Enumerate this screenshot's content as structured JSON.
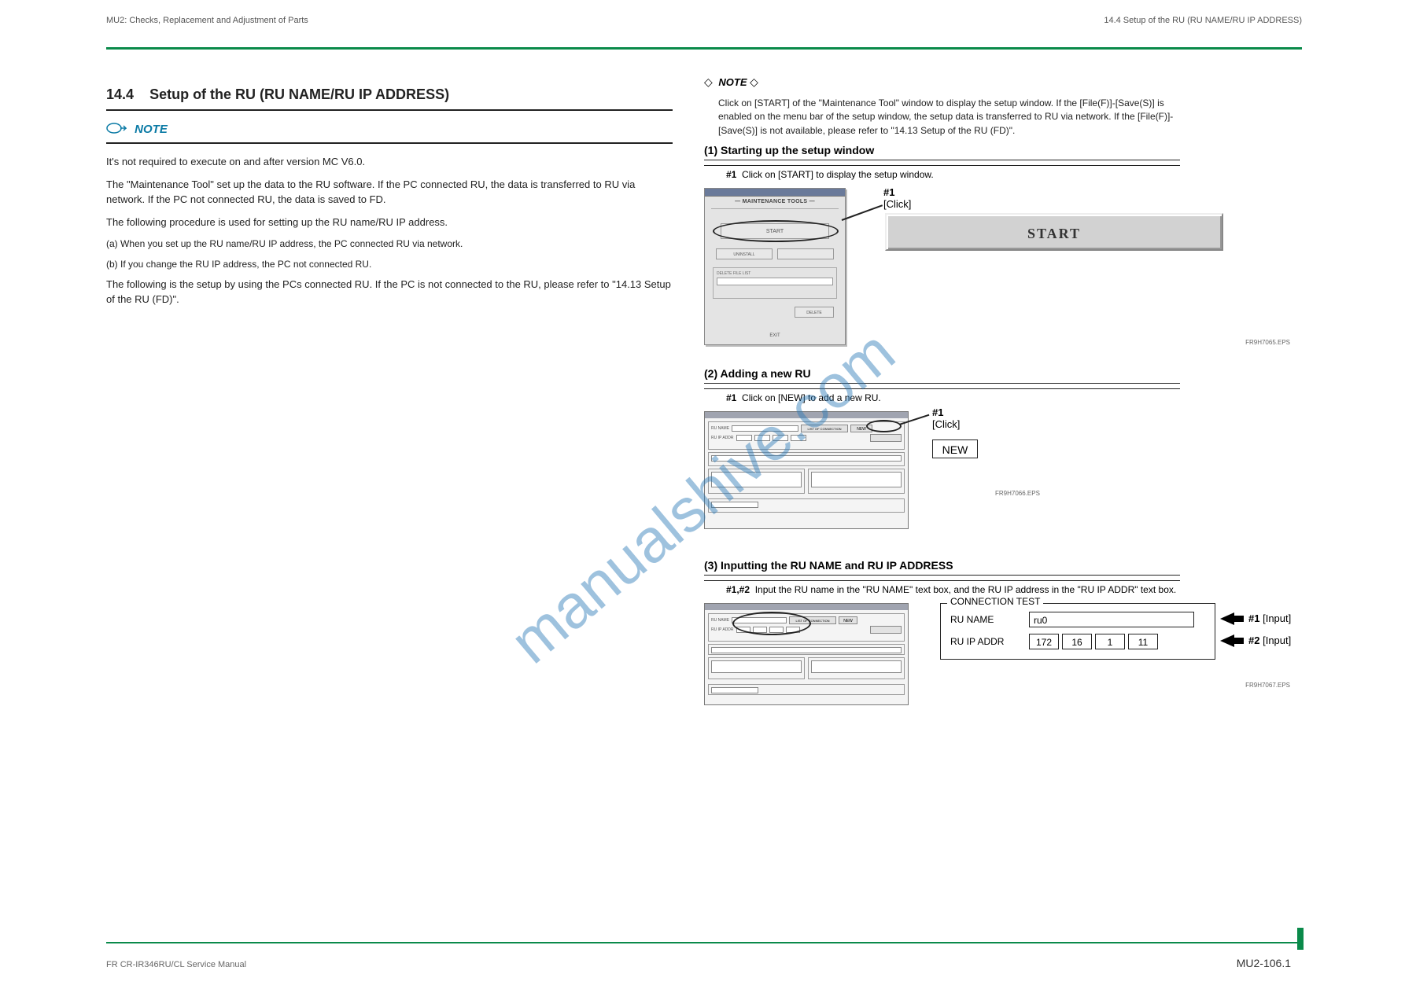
{
  "header": {
    "left": "MU2: Checks, Replacement and Adjustment of Parts",
    "right": "14.4 Setup of the RU (RU NAME/RU IP ADDRESS)"
  },
  "left_col": {
    "section_number": "14.4",
    "section_title": "Setup of the RU (RU NAME/RU IP ADDRESS)",
    "note_label": "NOTE",
    "note_text": "It's not required to execute on and after version MC V6.0.",
    "para1": "The \"Maintenance Tool\" set up the data to the RU software. If the PC connected RU, the data is transferred to RU via network. If the PC not connected RU, the data is saved to FD.",
    "para2": "The following procedure is used for setting up the RU name/RU IP address.",
    "item_a": "(a) When you set up the RU name/RU IP address, the PC connected RU via network.",
    "item_b": "(b) If you change the RU IP address, the PC not connected RU.",
    "ref": "The following is the setup by using the PCs connected RU. If the PC is not connected to the RU, please refer to \"14.13 Setup of the RU (FD)\"."
  },
  "right_col": {
    "note_diamond": "NOTE",
    "note_text": "Click on [START] of the \"Maintenance Tool\" window to display the setup window. If the [File(F)]-[Save(S)] is enabled on the menu bar of the setup window, the setup data is transferred to RU via network. If the [File(F)]-[Save(S)] is not available, please refer to \"14.13 Setup of the RU (FD)\".",
    "step1_title": "(1) Starting up the setup window",
    "step1_hash": "#1",
    "step1_detail": "Click on [START] to display the setup window.",
    "app_banner": "MAINTENANCE TOOLS",
    "app_start": "START",
    "app_uninstall": "UNINSTALL",
    "app_delete": "DELETE",
    "app_group": "DELETE FILE LIST",
    "app_exit": "EXIT",
    "callout1_num": "#1",
    "callout1_txt": "[Click]",
    "start_big": "START",
    "fig1_code": "FR9H7065.EPS",
    "step2_title": "(2) Adding a new RU",
    "step2_hash": "#1",
    "step2_detail": "Click on [NEW] to add a new RU.",
    "dlg_listbtn": "LIST OF CONNECTION",
    "dlg_new": "NEW",
    "dlg_runame": "RU NAME",
    "dlg_ruip": "RU IP ADDR",
    "callout2_num": "#1",
    "callout2_txt": "[Click]",
    "new_badge": "NEW",
    "fig2_code": "FR9H7066.EPS",
    "step3_title": "(3) Inputting the RU NAME and RU IP ADDRESS",
    "step3_hash12": "#1,#2",
    "step3_detail": "Input the RU name in the \"RU NAME\" text box, and the RU IP address in the \"RU IP ADDR\" text box.",
    "conn_legend": "CONNECTION TEST",
    "conn_runame_label": "RU NAME",
    "conn_runame_val": "ru0",
    "conn_ruip_label": "RU IP ADDR",
    "conn_ip": [
      "172",
      "16",
      "1",
      "11"
    ],
    "input1_num": "#1",
    "input1_txt": "[Input]",
    "input2_num": "#2",
    "input2_txt": "[Input]",
    "fig3_code": "FR9H7067.EPS"
  },
  "footer": {
    "left": "FR CR-IR346RU/CL Service Manual",
    "right": "MU2-106.1"
  },
  "watermark": "manualshive.com"
}
